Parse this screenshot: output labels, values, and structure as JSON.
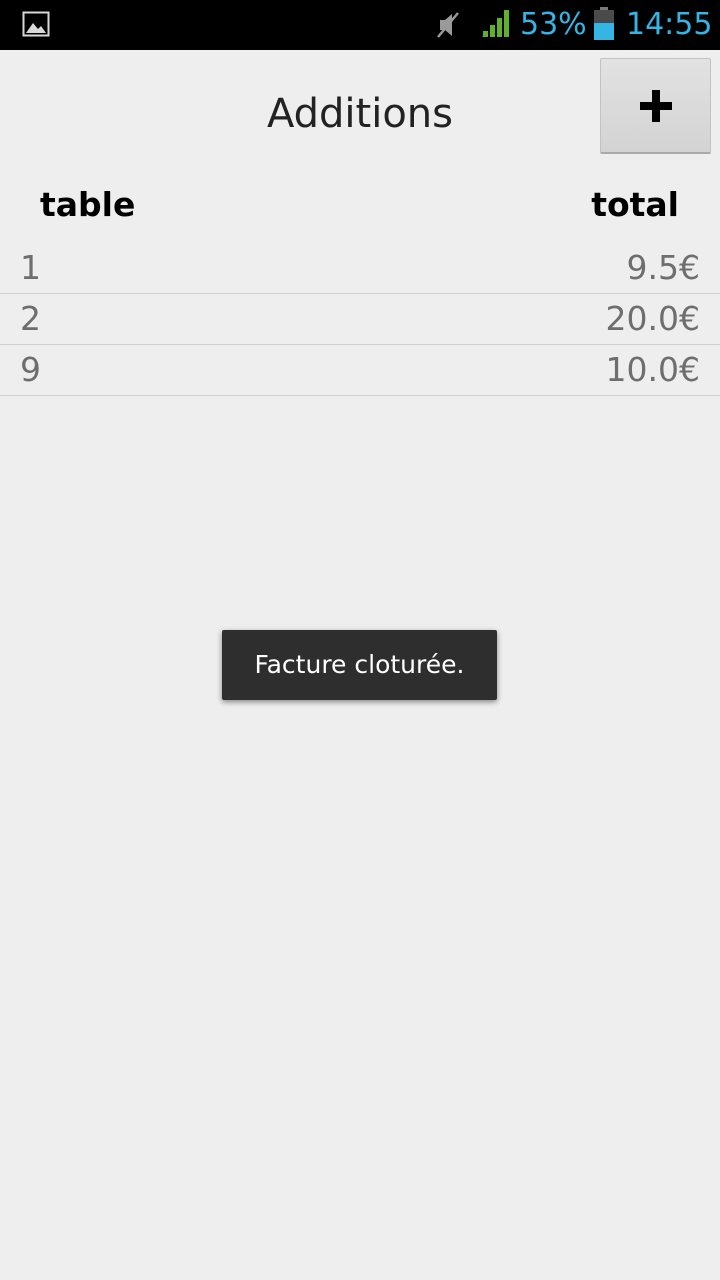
{
  "status_bar": {
    "battery_percent": "53%",
    "time": "14:55",
    "left_icon": "image-notification-icon",
    "icons": [
      "muted-speaker-icon",
      "signal-strength-icon",
      "battery-icon"
    ],
    "accent_color": "#33b5e5"
  },
  "header": {
    "title": "Additions",
    "add_button_icon": "plus-icon"
  },
  "list": {
    "columns": [
      "table",
      "total"
    ],
    "rows": [
      {
        "table": "1",
        "total": "9.5€"
      },
      {
        "table": "2",
        "total": "20.0€"
      },
      {
        "table": "9",
        "total": "10.0€"
      }
    ]
  },
  "toast": {
    "message": "Facture cloturée."
  }
}
